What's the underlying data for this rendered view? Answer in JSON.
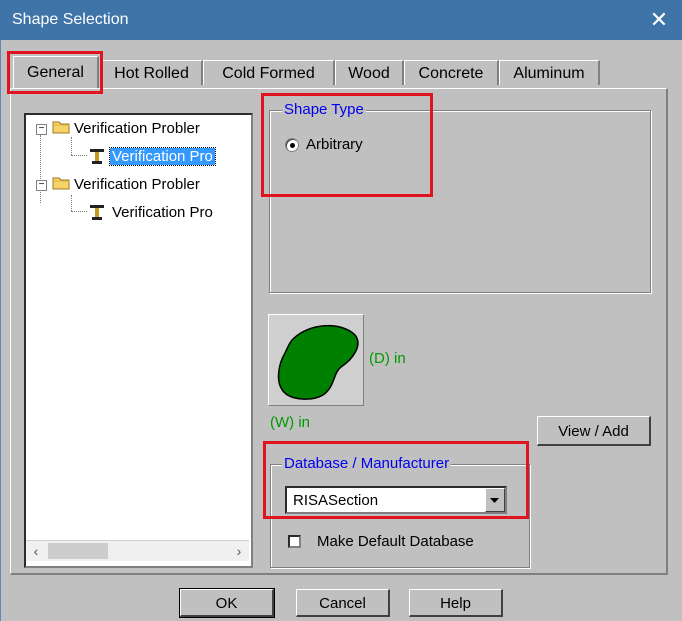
{
  "window": {
    "title": "Shape Selection",
    "close_label": "✕",
    "accent": "#3f74a8"
  },
  "tabs": [
    {
      "label": "General",
      "active": true
    },
    {
      "label": "Hot Rolled"
    },
    {
      "label": "Cold Formed"
    },
    {
      "label": "Wood"
    },
    {
      "label": "Concrete"
    },
    {
      "label": "Aluminum"
    }
  ],
  "tree": {
    "items": [
      {
        "label": "Verification Probler",
        "icon": "folder-icon",
        "expanded": true
      },
      {
        "label": "Verification Pro",
        "icon": "i-beam-icon",
        "selected": true
      },
      {
        "label": "Verification Probler",
        "icon": "folder-icon",
        "expanded": true
      },
      {
        "label": "Verification Pro",
        "icon": "i-beam-icon"
      }
    ],
    "scroll_left": "‹",
    "scroll_right": "›"
  },
  "shape_type": {
    "legend": "Shape Type",
    "option_label": "Arbitrary",
    "selected": true
  },
  "preview": {
    "d_label": "(D) in",
    "w_label": "(W) in",
    "shape_color": "#008000"
  },
  "buttons": {
    "view_add": "View / Add",
    "ok": "OK",
    "cancel": "Cancel",
    "help": "Help"
  },
  "database": {
    "legend": "Database / Manufacturer",
    "selected_value": "RISASection",
    "make_default_label": "Make Default Database",
    "make_default_checked": false
  },
  "highlight_color": "#e0141e"
}
